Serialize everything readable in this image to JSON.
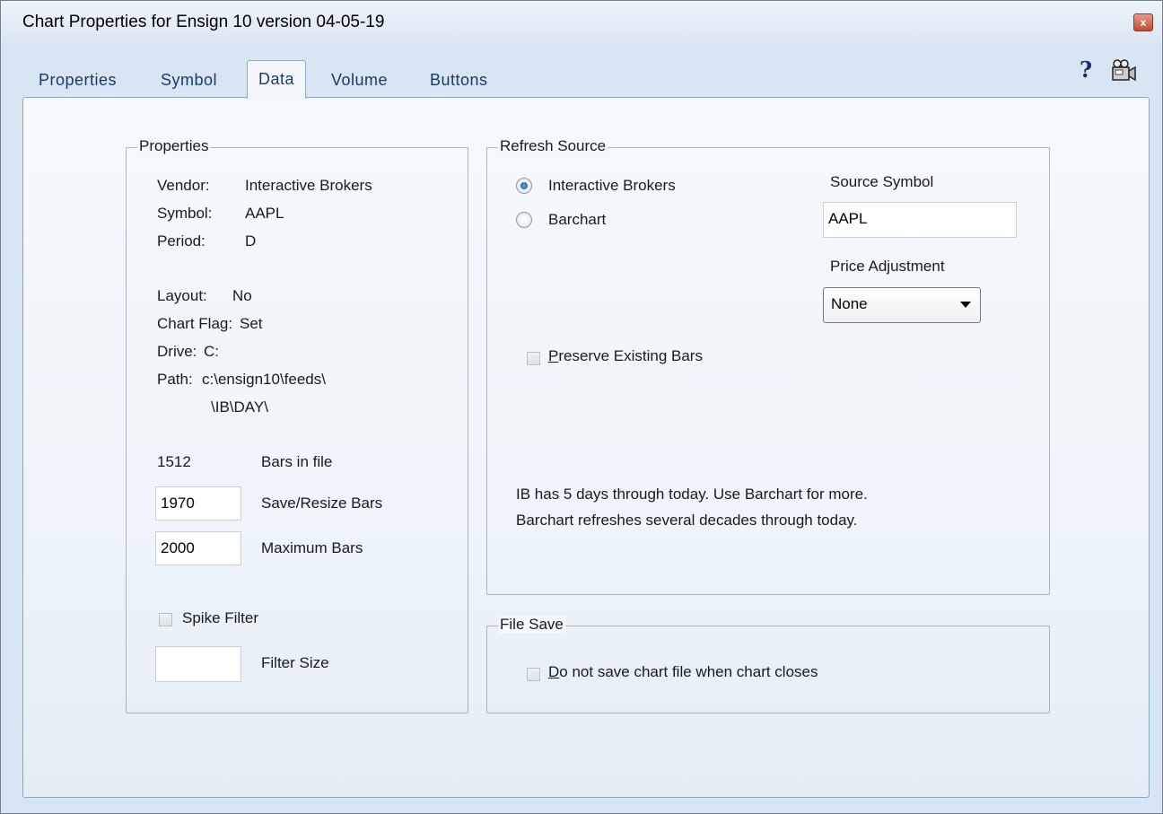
{
  "window": {
    "title": "Chart Properties for Ensign 10 version 04-05-19",
    "close_glyph": "x"
  },
  "tabs": [
    {
      "label": "Properties"
    },
    {
      "label": "Symbol"
    },
    {
      "label": "Data",
      "active": true
    },
    {
      "label": "Volume"
    },
    {
      "label": "Buttons"
    }
  ],
  "toolbar": {
    "help_glyph": "?",
    "help_icon": "help-icon",
    "camera_icon": "camera-icon"
  },
  "properties_group": {
    "title": "Properties",
    "vendor_label": "Vendor:",
    "vendor_value": "Interactive Brokers",
    "symbol_label": "Symbol:",
    "symbol_value": "AAPL",
    "period_label": "Period:",
    "period_value": "D",
    "layout_label": "Layout:",
    "layout_value": "No",
    "chart_flag_label": "Chart Flag:",
    "chart_flag_value": "Set",
    "drive_label": "Drive:",
    "drive_value": "C:",
    "path_label": "Path:",
    "path_line1": "c:\\ensign10\\feeds\\",
    "path_line2": "\\IB\\DAY\\",
    "bars_in_file_value": "1512",
    "bars_in_file_label": "Bars in file",
    "save_resize_value": "1970",
    "save_resize_label": "Save/Resize Bars",
    "maximum_bars_value": "2000",
    "maximum_bars_label": "Maximum Bars",
    "spike_filter_label": "Spike Filter",
    "spike_filter_checked": false,
    "filter_size_value": "",
    "filter_size_label": "Filter Size"
  },
  "refresh_group": {
    "title": "Refresh Source",
    "options": [
      {
        "label": "Interactive Brokers",
        "checked": true
      },
      {
        "label": "Barchart",
        "checked": false
      }
    ],
    "source_symbol_label": "Source Symbol",
    "source_symbol_value": "AAPL",
    "price_adjustment_label": "Price Adjustment",
    "price_adjustment_value": "None",
    "preserve_mnemonic": "P",
    "preserve_rest": "reserve Existing Bars",
    "preserve_checked": false,
    "info_line1": "IB has 5 days through today.  Use Barchart for more.",
    "info_line2": "Barchart refreshes several decades through today."
  },
  "file_save_group": {
    "title": "File Save",
    "no_save_mnemonic": "D",
    "no_save_rest": "o not save chart file when chart closes",
    "no_save_checked": false
  }
}
